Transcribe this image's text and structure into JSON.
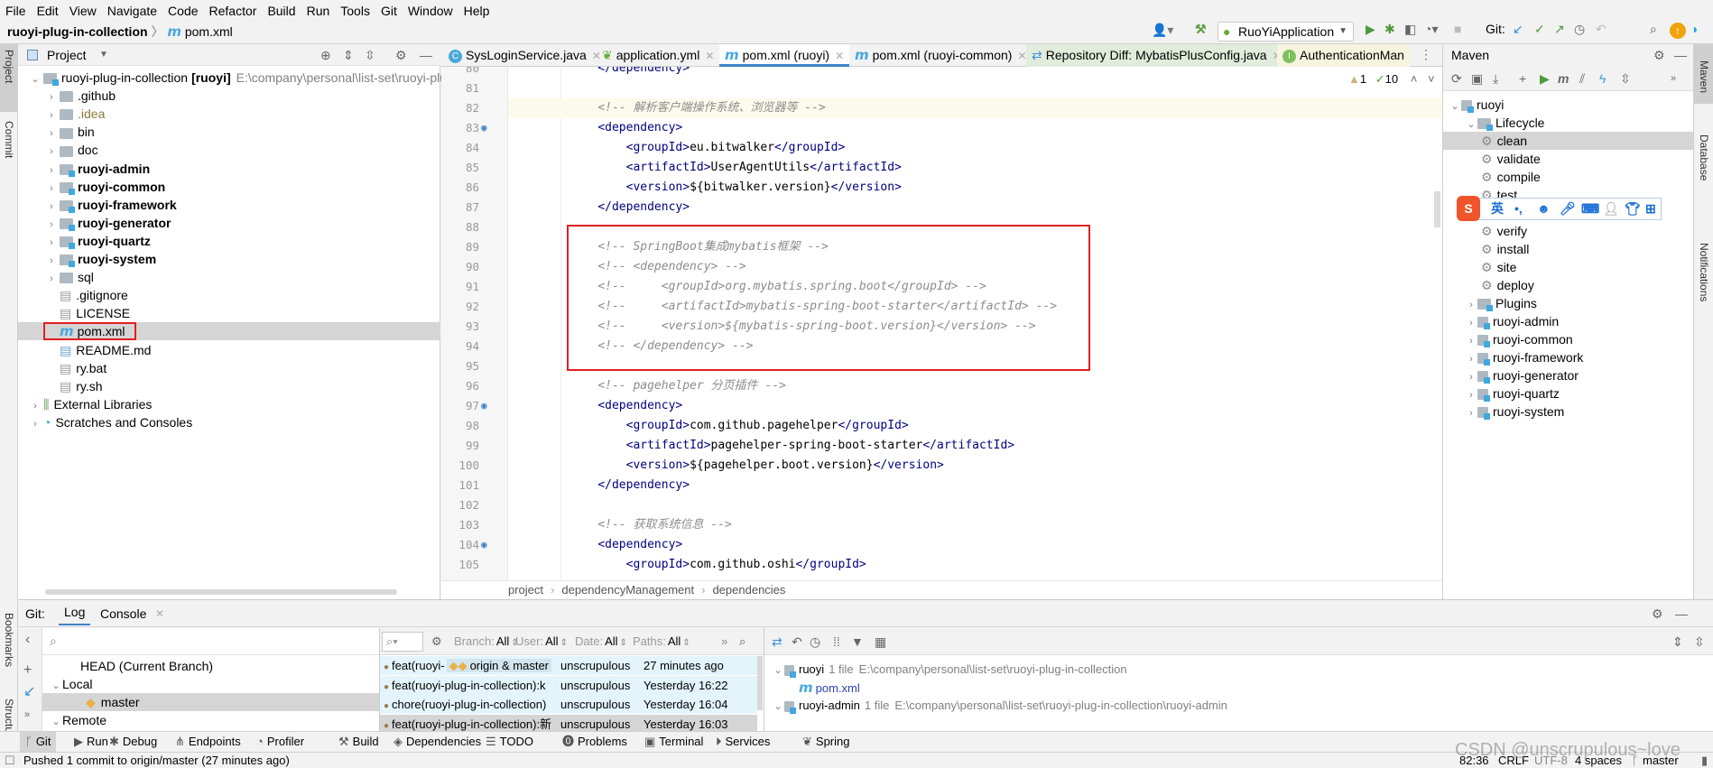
{
  "menu": [
    "File",
    "Edit",
    "View",
    "Navigate",
    "Code",
    "Refactor",
    "Build",
    "Run",
    "Tools",
    "Git",
    "Window",
    "Help"
  ],
  "nav": {
    "project": "ruoyi-plug-in-collection",
    "file": "pom.xml"
  },
  "toolbar": {
    "run_config": "RuoYiApplication",
    "git_label": "Git:"
  },
  "left_strip": {
    "project": "Project",
    "commit": "Commit",
    "bookmarks": "Bookmarks",
    "structure": "Structure"
  },
  "right_strip": {
    "maven": "Maven",
    "database": "Database",
    "notifications": "Notifications"
  },
  "project_panel": {
    "title": "Project",
    "tree": [
      {
        "label": "ruoyi-plug-in-collection",
        "bold_suffix": "[ruoyi]",
        "hint": "E:\\company\\personal\\list-set\\ruoyi-plug-",
        "level": 0,
        "arrow": "v",
        "icon": "module"
      },
      {
        "label": ".github",
        "level": 1,
        "arrow": ">",
        "icon": "folder"
      },
      {
        "label": ".idea",
        "level": 1,
        "arrow": ">",
        "icon": "folder",
        "color": "#8a7a3a"
      },
      {
        "label": "bin",
        "level": 1,
        "arrow": ">",
        "icon": "folder"
      },
      {
        "label": "doc",
        "level": 1,
        "arrow": ">",
        "icon": "folder"
      },
      {
        "label": "ruoyi-admin",
        "level": 1,
        "arrow": ">",
        "icon": "module",
        "bold": true
      },
      {
        "label": "ruoyi-common",
        "level": 1,
        "arrow": ">",
        "icon": "module",
        "bold": true
      },
      {
        "label": "ruoyi-framework",
        "level": 1,
        "arrow": ">",
        "icon": "module",
        "bold": true
      },
      {
        "label": "ruoyi-generator",
        "level": 1,
        "arrow": ">",
        "icon": "module",
        "bold": true
      },
      {
        "label": "ruoyi-quartz",
        "level": 1,
        "arrow": ">",
        "icon": "module",
        "bold": true
      },
      {
        "label": "ruoyi-system",
        "level": 1,
        "arrow": ">",
        "icon": "module",
        "bold": true
      },
      {
        "label": "sql",
        "level": 1,
        "arrow": ">",
        "icon": "folder"
      },
      {
        "label": ".gitignore",
        "level": 1,
        "icon": "file"
      },
      {
        "label": "LICENSE",
        "level": 1,
        "icon": "file"
      },
      {
        "label": "pom.xml",
        "level": 1,
        "icon": "maven",
        "selected": true
      },
      {
        "label": "README.md",
        "level": 1,
        "icon": "md"
      },
      {
        "label": "ry.bat",
        "level": 1,
        "icon": "file"
      },
      {
        "label": "ry.sh",
        "level": 1,
        "icon": "file"
      },
      {
        "label": "External Libraries",
        "level": 0,
        "arrow": ">",
        "icon": "lib"
      },
      {
        "label": "Scratches and Consoles",
        "level": 0,
        "arrow": ">",
        "icon": "scratch"
      }
    ]
  },
  "editor": {
    "tabs": [
      {
        "label": "SysLoginService.java",
        "icon": "C",
        "icon_color": "#4aa8de"
      },
      {
        "label": "application.yml",
        "icon": "leaf",
        "icon_color": "#6aab3f"
      },
      {
        "label": "pom.xml (ruoyi)",
        "icon": "m",
        "active": true
      },
      {
        "label": "pom.xml (ruoyi-common)",
        "icon": "m"
      },
      {
        "label": "Repository Diff: MybatisPlusConfig.java",
        "icon": "diff",
        "bg": "#e1ecdc"
      },
      {
        "label": "AuthenticationMan",
        "icon": "I",
        "icon_color": "#7fbf5f",
        "bg": "#f6f4df"
      }
    ],
    "inspections": {
      "warnings": "1",
      "ok": "10"
    },
    "code": {
      "lines": [
        {
          "num": "80",
          "text": "    </dependency>"
        },
        {
          "num": "81",
          "text": ""
        },
        {
          "num": "82",
          "text": "    <!-- 解析客户端操作系统、浏览器等 -->",
          "current": true
        },
        {
          "num": "83",
          "text": "    <dependency>",
          "gutter": true
        },
        {
          "num": "84",
          "text": "        <groupId>eu.bitwalker</groupId>"
        },
        {
          "num": "85",
          "text": "        <artifactId>UserAgentUtils</artifactId>"
        },
        {
          "num": "86",
          "text": "        <version>${bitwalker.version}</version>"
        },
        {
          "num": "87",
          "text": "    </dependency>"
        },
        {
          "num": "88",
          "text": ""
        },
        {
          "num": "89",
          "text": "    <!-- SpringBoot集成mybatis框架 -->"
        },
        {
          "num": "90",
          "text": "    <!-- <dependency> -->"
        },
        {
          "num": "91",
          "text": "    <!--     <groupId>org.mybatis.spring.boot</groupId> -->"
        },
        {
          "num": "92",
          "text": "    <!--     <artifactId>mybatis-spring-boot-starter</artifactId> -->"
        },
        {
          "num": "93",
          "text": "    <!--     <version>${mybatis-spring-boot.version}</version> -->"
        },
        {
          "num": "94",
          "text": "    <!-- </dependency> -->"
        },
        {
          "num": "95",
          "text": ""
        },
        {
          "num": "96",
          "text": "    <!-- pagehelper 分页插件 -->"
        },
        {
          "num": "97",
          "text": "    <dependency>",
          "gutter": true
        },
        {
          "num": "98",
          "text": "        <groupId>com.github.pagehelper</groupId>"
        },
        {
          "num": "99",
          "text": "        <artifactId>pagehelper-spring-boot-starter</artifactId>"
        },
        {
          "num": "100",
          "text": "        <version>${pagehelper.boot.version}</version>"
        },
        {
          "num": "101",
          "text": "    </dependency>"
        },
        {
          "num": "102",
          "text": ""
        },
        {
          "num": "103",
          "text": "    <!-- 获取系统信息 -->"
        },
        {
          "num": "104",
          "text": "    <dependency>",
          "gutter": true
        },
        {
          "num": "105",
          "text": "        <groupId>com.github.oshi</groupId>"
        }
      ]
    },
    "breadcrumb": [
      "project",
      "dependencyManagement",
      "dependencies"
    ]
  },
  "maven": {
    "title": "Maven",
    "tree": [
      {
        "label": "ruoyi",
        "level": 0,
        "arrow": "v",
        "icon": "maven-module",
        "row": 0
      },
      {
        "label": "Lifecycle",
        "level": 1,
        "arrow": "v",
        "icon": "folder-gear",
        "row": 1
      },
      {
        "label": "clean",
        "level": 2,
        "icon": "gear",
        "row": 2,
        "selected": true
      },
      {
        "label": "validate",
        "level": 2,
        "icon": "gear",
        "row": 3
      },
      {
        "label": "compile",
        "level": 2,
        "icon": "gear",
        "row": 4
      },
      {
        "label": "test",
        "level": 2,
        "icon": "gear",
        "row": 5
      },
      {
        "label": "verify",
        "level": 2,
        "icon": "gear",
        "row": 7
      },
      {
        "label": "install",
        "level": 2,
        "icon": "gear",
        "row": 8
      },
      {
        "label": "site",
        "level": 2,
        "icon": "gear",
        "row": 9
      },
      {
        "label": "deploy",
        "level": 2,
        "icon": "gear",
        "row": 10
      },
      {
        "label": "Plugins",
        "level": 1,
        "arrow": ">",
        "icon": "folder-gear",
        "row": 11
      },
      {
        "label": "ruoyi-admin",
        "level": 1,
        "arrow": ">",
        "icon": "maven-module",
        "row": 12
      },
      {
        "label": "ruoyi-common",
        "level": 1,
        "arrow": ">",
        "icon": "maven-module",
        "row": 13
      },
      {
        "label": "ruoyi-framework",
        "level": 1,
        "arrow": ">",
        "icon": "maven-module",
        "row": 14
      },
      {
        "label": "ruoyi-generator",
        "level": 1,
        "arrow": ">",
        "icon": "maven-module",
        "row": 15
      },
      {
        "label": "ruoyi-quartz",
        "level": 1,
        "arrow": ">",
        "icon": "maven-module",
        "row": 16
      },
      {
        "label": "ruoyi-system",
        "level": 1,
        "arrow": ">",
        "icon": "maven-module",
        "row": 17
      }
    ]
  },
  "ime_bar": {
    "lang": "英",
    "punct": "•,"
  },
  "git_panel": {
    "label": "Git:",
    "tabs": [
      "Log",
      "Console"
    ],
    "branches": [
      {
        "label": "HEAD (Current Branch)",
        "level": 1
      },
      {
        "label": "Local",
        "level": 0,
        "arrow": "v"
      },
      {
        "label": "master",
        "level": 2,
        "selected": true,
        "icon": "tag"
      },
      {
        "label": "Remote",
        "level": 0,
        "arrow": "v"
      }
    ],
    "filters": [
      {
        "name": "Branch:",
        "value": "All"
      },
      {
        "name": "User:",
        "value": "All"
      },
      {
        "name": "Date:",
        "value": "All"
      },
      {
        "name": "Paths:",
        "value": "All"
      }
    ],
    "commits": [
      {
        "msg": "feat(ruoyi-",
        "refs": "origin & master",
        "author": "unscrupulous",
        "time": "27 minutes ago",
        "selected": true
      },
      {
        "msg": "feat(ruoyi-plug-in-collection):k",
        "author": "unscrupulous",
        "time": "Yesterday 16:22",
        "selected": true
      },
      {
        "msg": "chore(ruoyi-plug-in-collection)",
        "author": "unscrupulous",
        "time": "Yesterday 16:04",
        "selected": true
      },
      {
        "msg": "feat(ruoyi-plug-in-collection):新",
        "author": "unscrupulous",
        "time": "Yesterday 16:03"
      }
    ],
    "changes": [
      {
        "label": "ruoyi",
        "count": "1 file",
        "path": "E:\\company\\personal\\list-set\\ruoyi-plug-in-collection",
        "level": 0
      },
      {
        "label": "pom.xml",
        "level": 1
      },
      {
        "label": "ruoyi-admin",
        "count": "1 file",
        "path": "E:\\company\\personal\\list-set\\ruoyi-plug-in-collection\\ruoyi-admin",
        "level": 0
      }
    ]
  },
  "tool_windows": [
    "Git",
    "Run",
    "Debug",
    "Endpoints",
    "Profiler",
    "Build",
    "Dependencies",
    "TODO",
    "Problems",
    "Terminal",
    "Services",
    "Spring"
  ],
  "status": {
    "message": "Pushed 1 commit to origin/master (27 minutes ago)",
    "position": "82:36",
    "line_sep": "CRLF",
    "encoding": "UTF-8",
    "indent": "4 spaces",
    "branch": "master"
  },
  "watermark": "CSDN @unscrupulous~love",
  "colors": {
    "accent": "#4083c9",
    "highlight_box": "#e02020",
    "tag": "#000080",
    "comment": "#8c8c8c",
    "selection": "#d5d5d5",
    "log_selected": "#e3f4fb"
  }
}
